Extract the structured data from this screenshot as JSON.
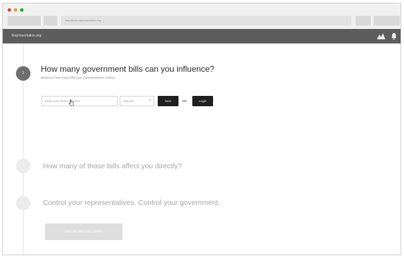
{
  "browser": {
    "url": "http://www.representation.org",
    "traffic_lights": [
      "#e0443e",
      "#dea123",
      "#1aab29"
    ]
  },
  "nav": {
    "brand": "Representation.org",
    "logo_icon": "mountains-logo-icon",
    "notification_icon": "bell-icon"
  },
  "steps": [
    {
      "number": "1",
      "question": "How many government bills can you influence?",
      "subtitle": "Based on how many bills your representatives control."
    },
    {
      "number": "2",
      "question": "How many of those bills affect you directly?"
    },
    {
      "number": "3",
      "question": "Control your representatives. Control your government."
    }
  ],
  "form": {
    "address_placeholder": "Enter your street address",
    "zipcode_placeholder": "Zipcode",
    "next_label": "Next",
    "or_label": "OR",
    "login_label": "Login"
  },
  "cta": {
    "view_bills_label": "View the bills they control"
  },
  "colors": {
    "nav_bg": "#5d5d5d",
    "button_dark": "#1f1f1f",
    "muted_text": "#a5a5a5"
  }
}
